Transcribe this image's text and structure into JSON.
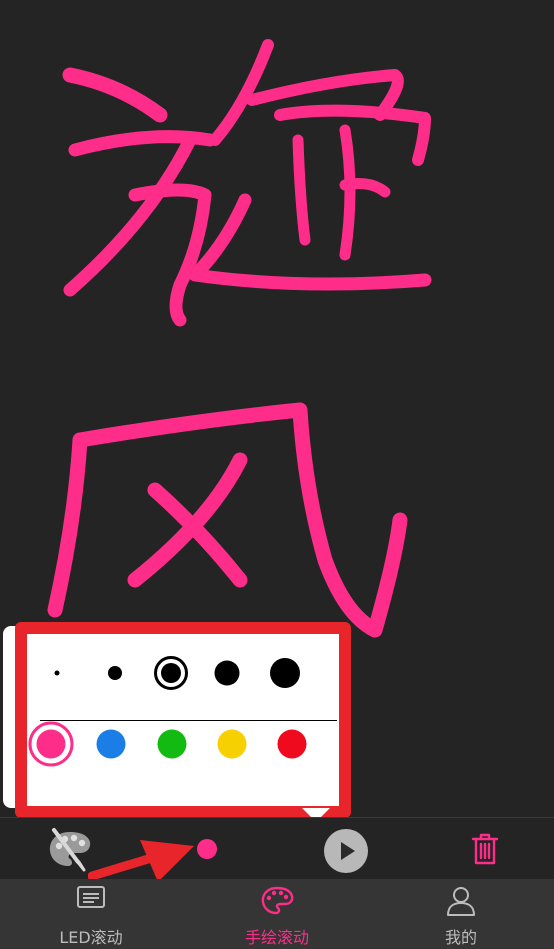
{
  "colors": {
    "ink": "#ff2d8a",
    "frame_highlight": "#e8252b",
    "arrow": "#e8252b",
    "background": "#242424",
    "tabbar": "#353535",
    "active_tab": "#ff2d8a",
    "inactive_tab": "#bcbcbc"
  },
  "drawing": {
    "characters": [
      "旋",
      "风"
    ]
  },
  "brush_popup": {
    "sizes": [
      "xsmall",
      "small",
      "medium",
      "large",
      "xlarge"
    ],
    "selected_size": "medium",
    "palette": [
      {
        "name": "pink",
        "hex": "#ff2d8a"
      },
      {
        "name": "blue",
        "hex": "#1a7ee6"
      },
      {
        "name": "green",
        "hex": "#12ba12"
      },
      {
        "name": "yellow",
        "hex": "#f6d000"
      },
      {
        "name": "red",
        "hex": "#f00a1e"
      }
    ],
    "selected_color": "pink"
  },
  "toolbar": {
    "items": [
      {
        "icon": "palette-brush-icon"
      },
      {
        "icon": "color-dot-icon"
      },
      {
        "icon": "play-icon"
      },
      {
        "icon": "trash-icon"
      }
    ]
  },
  "tabs": [
    {
      "label": "LED滚动",
      "icon": "led-board-icon",
      "active": false
    },
    {
      "label": "手绘滚动",
      "icon": "palette-icon",
      "active": true
    },
    {
      "label": "我的",
      "icon": "user-icon",
      "active": false
    }
  ]
}
